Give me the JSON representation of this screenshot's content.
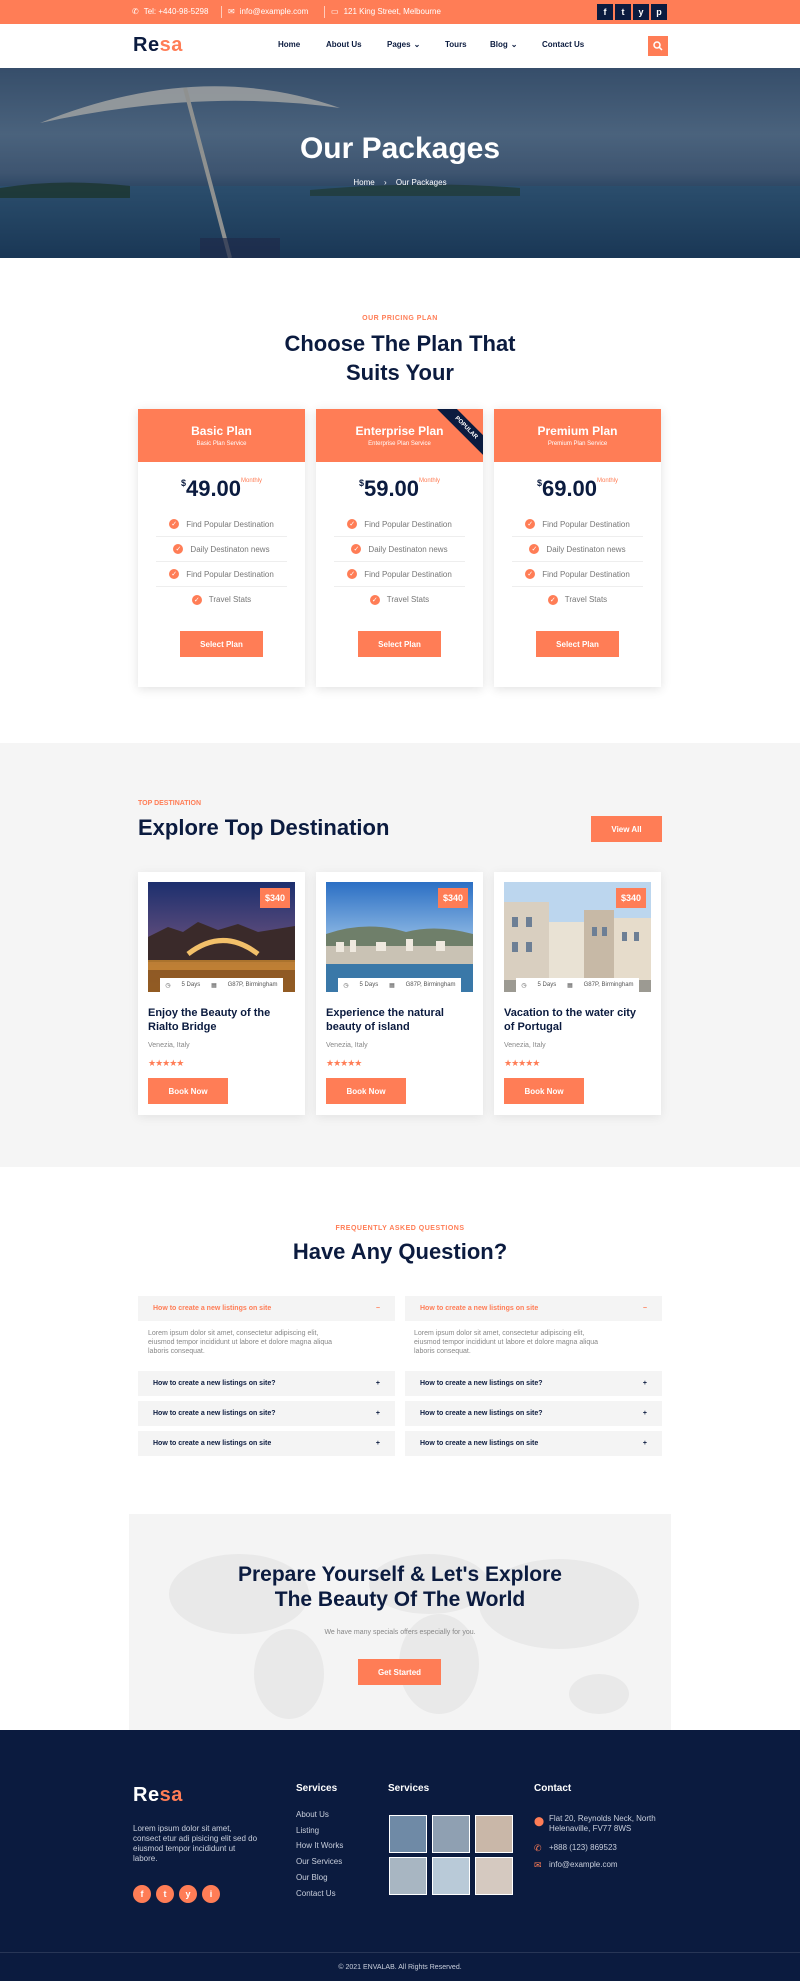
{
  "topbar": {
    "phone": "Tel: +440-98-5298",
    "email": "info@example.com",
    "address": "121 King Street, Melbourne",
    "social": [
      "f",
      "t",
      "y",
      "p"
    ]
  },
  "brand": {
    "logo_a": "Re",
    "logo_b": "sa",
    "accent": "#ff7d56",
    "navy": "#0b1b3f"
  },
  "nav": {
    "items": [
      {
        "label": "Home",
        "dropdown": false
      },
      {
        "label": "About Us",
        "dropdown": false
      },
      {
        "label": "Pages",
        "dropdown": true
      },
      {
        "label": "Tours",
        "dropdown": false
      },
      {
        "label": "Blog",
        "dropdown": true
      },
      {
        "label": "Contact Us",
        "dropdown": false
      }
    ]
  },
  "hero": {
    "title": "Our Packages",
    "crumb_home": "Home",
    "crumb_sep": "›",
    "crumb_current": "Our Packages"
  },
  "pricing": {
    "kicker": "OUR PRICING PLAN",
    "title_line1": "Choose The Plan That",
    "title_line2": "Suits Your",
    "plans": [
      {
        "name": "Basic Plan",
        "sub": "Basic Plan Service",
        "currency": "$",
        "price": "49.00",
        "period": "Monthly",
        "features": [
          "Find Popular Destination",
          "Daily Destinaton news",
          "Find Popular Destination",
          "Travel Stats"
        ],
        "button": "Select Plan",
        "badge": ""
      },
      {
        "name": "Enterprise Plan",
        "sub": "Enterprise Plan Service",
        "currency": "$",
        "price": "59.00",
        "period": "Monthly",
        "features": [
          "Find Popular Destination",
          "Daily Destinaton news",
          "Find Popular Destination",
          "Travel Stats"
        ],
        "button": "Select Plan",
        "badge": "POPULAR"
      },
      {
        "name": "Premium Plan",
        "sub": "Premium Plan Service",
        "currency": "$",
        "price": "69.00",
        "period": "Monthly",
        "features": [
          "Find Popular Destination",
          "Daily Destinaton news",
          "Find Popular Destination",
          "Travel Stats"
        ],
        "button": "Select Plan",
        "badge": ""
      }
    ]
  },
  "destinations": {
    "kicker": "TOP DESTINATION",
    "title": "Explore Top Destination",
    "view_all": "View All",
    "cards": [
      {
        "price": "$340",
        "days": "5 Days",
        "location_tag": "G87P, Birmingham",
        "title_l1": "Enjoy the Beauty of the",
        "title_l2": "Rialto Bridge",
        "place": "Venezia, Italy",
        "stars": "★★★★★",
        "rating": 4.5,
        "button": "Book Now"
      },
      {
        "price": "$340",
        "days": "5 Days",
        "location_tag": "G87P, Birmingham",
        "title_l1": "Experience the natural",
        "title_l2": "beauty of island",
        "place": "Venezia, Italy",
        "stars": "★★★★★",
        "rating": 4,
        "button": "Book Now"
      },
      {
        "price": "$340",
        "days": "5 Days",
        "location_tag": "G87P, Birmingham",
        "title_l1": "Vacation to the water city",
        "title_l2": "of Portugal",
        "place": "Venezia, Italy",
        "stars": "★★★★★",
        "rating": 5,
        "button": "Book Now"
      }
    ]
  },
  "faq": {
    "kicker": "FREQUENTLY ASKED QUESTIONS",
    "title": "Have Any Question?",
    "left": [
      {
        "q": "How to create a new listings on site",
        "icon": "−",
        "open": true
      },
      {
        "q": "How to create a new listings on site?",
        "icon": "+"
      },
      {
        "q": "How to create a new listings on site?",
        "icon": "+"
      },
      {
        "q": "How to create a new listings on site",
        "icon": "+"
      }
    ],
    "right": [
      {
        "q": "How to create a new listings on site",
        "icon": "−",
        "open": true
      },
      {
        "q": "How to create a new listings on site?",
        "icon": "+"
      },
      {
        "q": "How to create a new listings on site?",
        "icon": "+"
      },
      {
        "q": "How to create a new listings on site",
        "icon": "+"
      }
    ],
    "answer_l1": "Lorem ipsum dolor sit amet, consectetur adipiscing elit,",
    "answer_l2": "eiusmod tempor incididunt ut labore et dolore magna aliqua",
    "answer_l3": "laboris consequat."
  },
  "cta": {
    "title_l1": "Prepare Yourself & Let's Explore",
    "title_l2": "The Beauty Of The World",
    "text": "We have many specials offers especially for you.",
    "button": "Get Started"
  },
  "footer": {
    "about_l1": "Lorem ipsum dolor sit amet,",
    "about_l2": "consect etur adi pisicing elit sed do",
    "about_l3": "eiusmod tempor incididunt ut",
    "about_l4": "labore.",
    "social": [
      "f",
      "t",
      "y",
      "i"
    ],
    "col1_title": "Services",
    "col1_links": [
      "About Us",
      "Listing",
      "How It Works",
      "Our Services",
      "Our Blog",
      "Contact Us"
    ],
    "col2_title": "Services",
    "col3_title": "Contact",
    "address_l1": "Flat 20, Reynolds Neck, North",
    "address_l2": "Helenaville, FV77 8WS",
    "phone": "+888 (123) 869523",
    "email": "info@example.com",
    "copyright": "© 2021 ENVALAB. All Rights Reserved."
  }
}
